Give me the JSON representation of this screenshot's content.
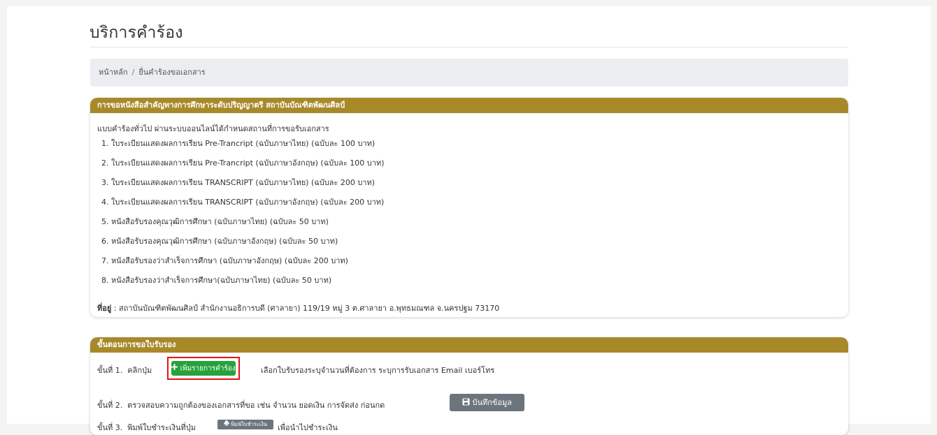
{
  "page": {
    "title": "บริการคำร้อง"
  },
  "breadcrumb": {
    "home": "หน้าหลัก",
    "separator": "/",
    "current": "ยื่นคำร้องขอเอกสาร"
  },
  "card1": {
    "header": "การขอหนังสือสำคัญทางการศึกษาระดับปริญญาตรี สถาบันบัณฑิตพัฒนศิลป์",
    "intro": "แบบคำร้องทั่วไป ผ่านระบบออนไลน์ได้กำหนดสถานที่การขอรับเอกสาร",
    "items": [
      "1. ใบระเบียนแสดงผลการเรียน Pre-Trancript (ฉบับภาษาไทย) (ฉบับละ 100 บาท)",
      "2. ใบระเบียนแสดงผลการเรียน Pre-Trancript (ฉบับภาษาอังกฤษ) (ฉบับละ 100 บาท)",
      "3. ใบระเบียนแสดงผลการเรียน TRANSCRIPT (ฉบับภาษาไทย) (ฉบับละ 200 บาท)",
      "4. ใบระเบียนแสดงผลการเรียน TRANSCRIPT (ฉบับภาษาอังกฤษ) (ฉบับละ 200 บาท)",
      "5. หนังสือรับรองคุณวุฒิการศึกษา (ฉบับภาษาไทย) (ฉบับละ 50 บาท)",
      "6. หนังสือรับรองคุณวุฒิการศึกษา (ฉบับภาษาอังกฤษ) (ฉบับละ 50 บาท)",
      "7. หนังสือรับรองว่าสำเร็จการศึกษา (ฉบับภาษาอังกฤษ) (ฉบับละ 200 บาท)",
      "8. หนังสือรับรองว่าสำเร็จการศึกษา(ฉบับภาษาไทย) (ฉบับละ 50 บาท)"
    ],
    "address_label": "ที่อยู่",
    "address_text": ": สถาบันบัณฑิตพัฒนศิลป์ สำนักงานอธิการบดี (ศาลายา) 119/19 หมู่ 3 ต.ศาลายา อ.พุทธมณฑล จ.นครปฐม 73170"
  },
  "card2": {
    "header": "ขั้นตอนการขอใบรับรอง",
    "step1_label": "ขั้นที่ 1.",
    "step1_pre": "คลิกปุ่ม",
    "step1_button": "เพิ่มรายการคำร้อง",
    "step1_post": "เลือกใบรับรองระบุจำนวนที่ต้องการ ระบุการรับเอกสาร Email เบอร์โทร",
    "step2_label": "ขั้นที่ 2.",
    "step2_text": "ตรวจสอบความถูกต้องของเอกสารที่ขอ เช่น จำนวน ยอดเงิน การจัดส่ง ก่อนกด",
    "step2_button": "บันทึกข้อมูล",
    "step3_label": "ขั้นที่ 3.",
    "step3_pre": "พิมพ์ใบชำระเงินที่ปุ่ม",
    "step3_button": "พิมพ์ใบชำระเงิน",
    "step3_post": "เพื่อนำไปชำระเงิน"
  },
  "colors": {
    "header_gold": "#a8892a",
    "add_green": "#26a23c",
    "button_gray": "#6c757d",
    "highlight_red": "#e01414"
  },
  "icons": {
    "add": "plus-icon",
    "save": "floppy-disk-icon",
    "print": "printer-icon"
  }
}
